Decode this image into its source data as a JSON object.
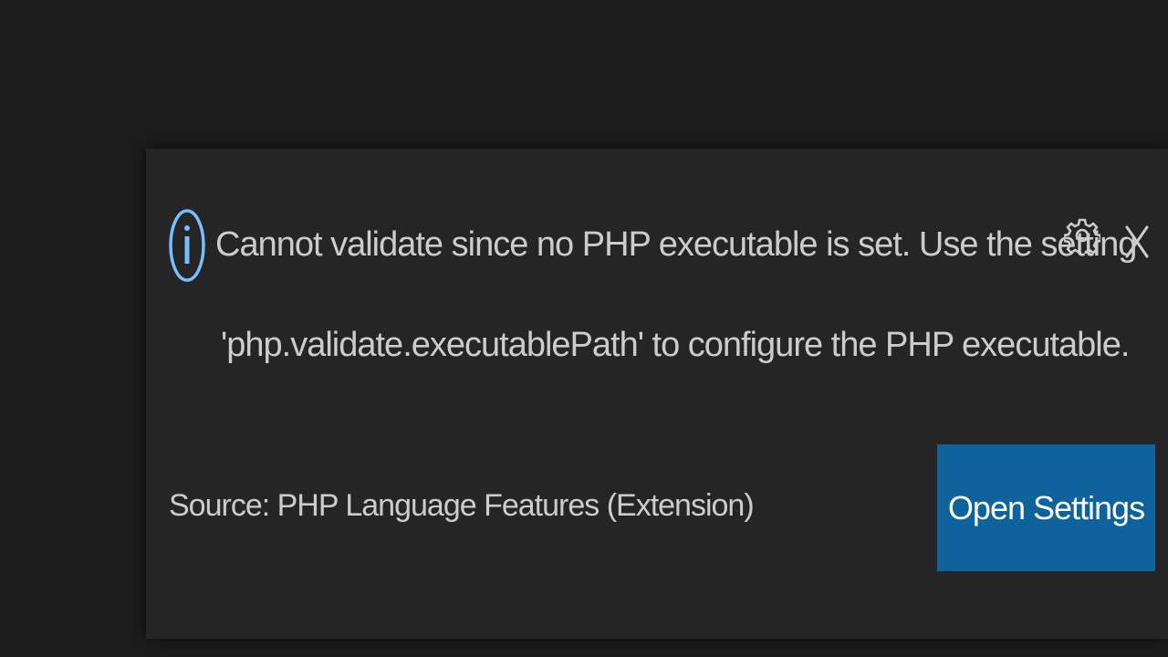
{
  "notification": {
    "message_line1": "Cannot validate since no PHP executable is set. Use the setting",
    "message_line2": "'php.validate.executablePath' to configure the PHP executable.",
    "source": "Source: PHP Language Features (Extension)",
    "primary_action_label": "Open Settings",
    "icons": {
      "info": "info-icon",
      "settings": "gear-icon",
      "close": "close-icon"
    },
    "colors": {
      "background": "#252526",
      "text": "#cccccc",
      "info_icon": "#75beff",
      "button": "#0e639c",
      "button_text": "#ffffff"
    }
  }
}
